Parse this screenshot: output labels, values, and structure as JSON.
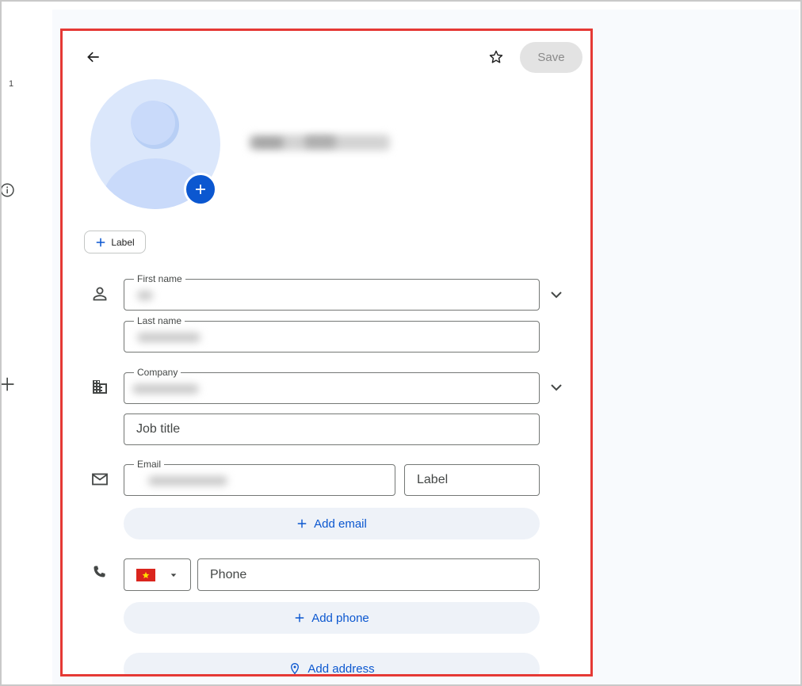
{
  "sidebar": {
    "number": "1"
  },
  "header": {
    "save_label": "Save"
  },
  "contact": {
    "add_label": "Label"
  },
  "fields": {
    "first_name_label": "First name",
    "last_name_label": "Last name",
    "company_label": "Company",
    "job_title_placeholder": "Job title",
    "email_label": "Email",
    "email_label_placeholder": "Label",
    "phone_placeholder": "Phone"
  },
  "actions": {
    "add_email": "Add email",
    "add_phone": "Add phone",
    "add_address": "Add address"
  },
  "colors": {
    "accent": "#0b57d0",
    "highlight": "#e53935",
    "pill_bg": "#eef2f8",
    "avatar_bg": "#dbe7fb"
  }
}
